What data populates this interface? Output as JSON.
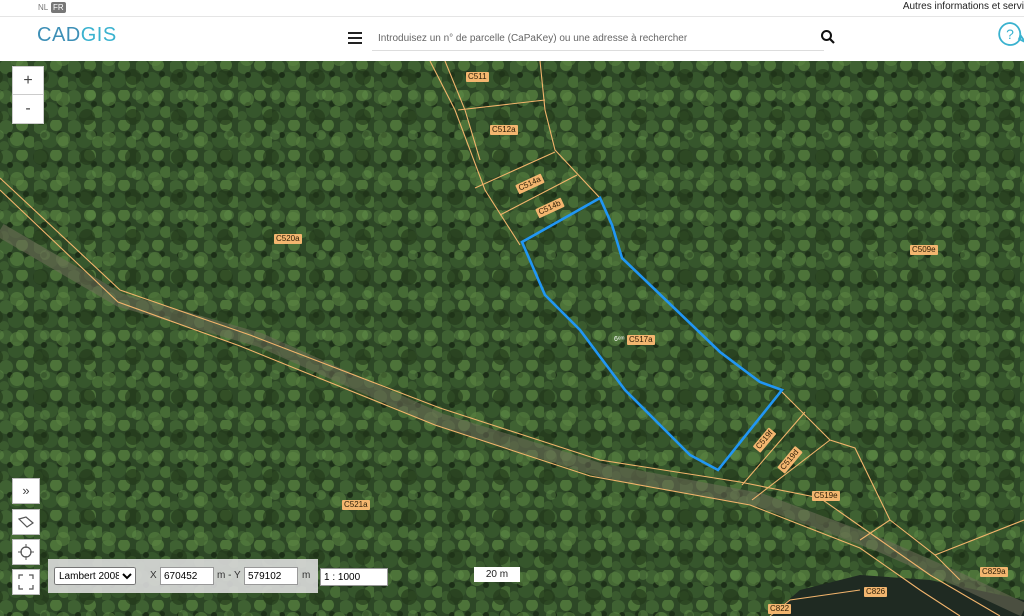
{
  "topbar": {
    "lang_nl": "NL",
    "lang_fr": "FR",
    "link": "Autres informations et servi"
  },
  "header": {
    "logo_part1": "CAD",
    "logo_part2": "GIS",
    "search_placeholder": "Introduisez un n° de parcelle (CaPaKey) ou une adresse à rechercher",
    "help": "?"
  },
  "icons": {
    "menu": "menu-icon",
    "search": "search-icon",
    "help": "help-icon",
    "zoom_in": "plus-icon",
    "zoom_out": "minus-icon",
    "expand": "double-chevron-right-icon",
    "draw": "polygon-draw-icon",
    "locate": "crosshair-icon",
    "fullscreen": "fullscreen-icon"
  },
  "map_controls": {
    "zoom_in": "+",
    "zoom_out": "-",
    "expand": "»"
  },
  "parcels": {
    "c511": "C511",
    "c512a": "C512a",
    "c514a": "C514a",
    "c514b": "C514b",
    "c520a": "C520a",
    "c509e": "C509e",
    "c517a": "C517a",
    "c517a_prefix": "6ᵉᵐ",
    "c519f": "C519f",
    "c519d": "C519d",
    "c519e": "C519e",
    "c521a": "C521a",
    "c829a": "C829a",
    "c826": "C826",
    "c822": "C822"
  },
  "coords": {
    "crs": "Lambert 2008",
    "x_label": "X",
    "x_value": "670452",
    "m_y_label": "m - Y",
    "y_value": "579102",
    "m_label": "m",
    "scale": "1 : 1000"
  },
  "scale_bar": "20 m",
  "colors": {
    "brand": "#3d8fb6",
    "brand_accent": "#3ab2cf",
    "parcel_line": "#f2b46c",
    "selected_parcel": "#2196f3",
    "label_bg": "#f3b66f"
  }
}
